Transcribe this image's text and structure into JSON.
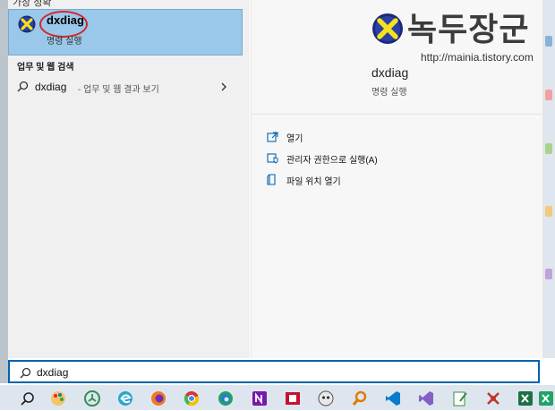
{
  "top_cut_heading": "가장 정확",
  "best_match": {
    "title": "dxdiag",
    "subtitle": "명령 실행"
  },
  "web_section": {
    "heading": "업무 및 웹 검색",
    "term": "dxdiag",
    "description": "- 업무 및 웹 결과 보기"
  },
  "watermark": {
    "korean": "녹두장군",
    "url": "http://mainia.tistory.com"
  },
  "detail": {
    "title": "dxdiag",
    "subtitle": "명령 실행"
  },
  "actions": [
    {
      "label": "열기",
      "icon": "open-icon"
    },
    {
      "label": "관리자 권한으로 실행(A)",
      "icon": "admin-shield-icon"
    },
    {
      "label": "파일 위치 열기",
      "icon": "file-location-icon"
    }
  ],
  "search": {
    "value": "dxdiag"
  },
  "taskbar": [
    {
      "name": "search-icon"
    },
    {
      "name": "paint-palette-icon"
    },
    {
      "name": "app-green-circle-icon"
    },
    {
      "name": "edge-legacy-icon"
    },
    {
      "name": "firefox-icon"
    },
    {
      "name": "chrome-icon"
    },
    {
      "name": "edge-icon"
    },
    {
      "name": "onenote-icon"
    },
    {
      "name": "film-app-icon"
    },
    {
      "name": "game-app-icon"
    },
    {
      "name": "magnifier-app-icon"
    },
    {
      "name": "vscode-icon"
    },
    {
      "name": "visual-studio-icon"
    },
    {
      "name": "notepad-icon"
    },
    {
      "name": "red-bug-app-icon"
    },
    {
      "name": "excel-icon"
    },
    {
      "name": "excel-alt-icon"
    }
  ],
  "colors": {
    "selection": "#99c8ea",
    "accent": "#0063b1",
    "highlight_circle": "#d6262c"
  }
}
